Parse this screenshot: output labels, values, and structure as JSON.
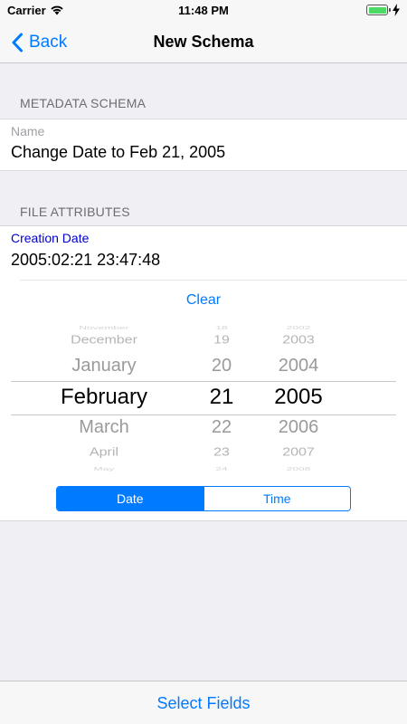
{
  "status_bar": {
    "carrier": "Carrier",
    "time": "11:48 PM",
    "battery_color": "#4cd964"
  },
  "nav": {
    "back_label": "Back",
    "title": "New Schema"
  },
  "metadata_section": {
    "header": "METADATA SCHEMA",
    "name_label": "Name",
    "name_value": "Change Date to Feb 21, 2005"
  },
  "file_attributes_section": {
    "header": "FILE ATTRIBUTES",
    "creation_date_label": "Creation Date",
    "creation_date_value": "2005:02:21 23:47:48",
    "clear_label": "Clear"
  },
  "picker": {
    "months": [
      "November",
      "December",
      "January",
      "February",
      "March",
      "April",
      "May"
    ],
    "days": [
      "18",
      "19",
      "20",
      "21",
      "22",
      "23",
      "24"
    ],
    "years": [
      "2002",
      "2003",
      "2004",
      "2005",
      "2006",
      "2007",
      "2008"
    ],
    "selected": {
      "month": "February",
      "day": "21",
      "year": "2005"
    }
  },
  "segmented_control": {
    "date_label": "Date",
    "time_label": "Time",
    "selected": "Date"
  },
  "toolbar": {
    "select_fields_label": "Select Fields"
  },
  "colors": {
    "accent": "#007aff",
    "label_blue": "#0000cc",
    "background": "#efeff4"
  },
  "icons": [
    "wifi-icon",
    "battery-icon",
    "charging-icon",
    "chevron-left-icon"
  ]
}
